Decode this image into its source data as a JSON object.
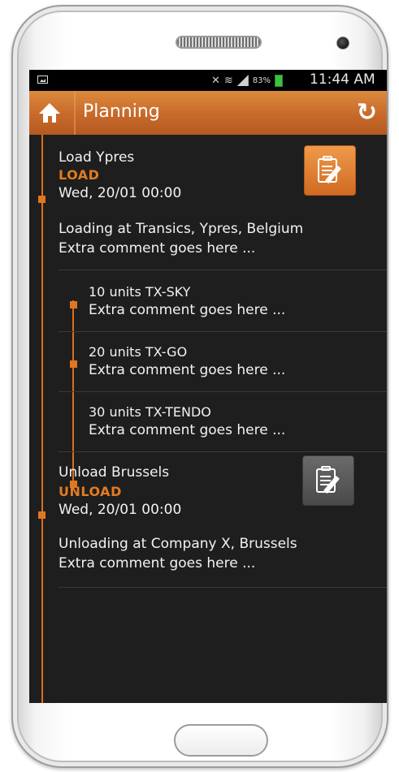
{
  "statusbar": {
    "battery_percent": "83%",
    "time": "11:44 AM"
  },
  "appbar": {
    "title": "Planning"
  },
  "stops": [
    {
      "title": "Load Ypres",
      "type": "LOAD",
      "date": "Wed, 20/01 00:00",
      "description_line1": "Loading at Transics, Ypres, Belgium",
      "description_line2": "Extra comment goes here ...",
      "button_color": "#e07720",
      "items": [
        {
          "title": "10 units TX-SKY",
          "comment": "Extra comment goes here ..."
        },
        {
          "title": "20 units TX-GO",
          "comment": "Extra comment goes here ..."
        },
        {
          "title": "30 units TX-TENDO",
          "comment": "Extra comment goes here ..."
        }
      ]
    },
    {
      "title": "Unload Brussels",
      "type": "UNLOAD",
      "date": "Wed, 20/01 00:00",
      "description_line1": "Unloading at Company X, Brussels",
      "description_line2": "Extra comment goes here ...",
      "button_color": "#555555"
    }
  ],
  "colors": {
    "accent": "#e07720",
    "background": "#1e1e1e",
    "text": "#f2f2f2"
  }
}
